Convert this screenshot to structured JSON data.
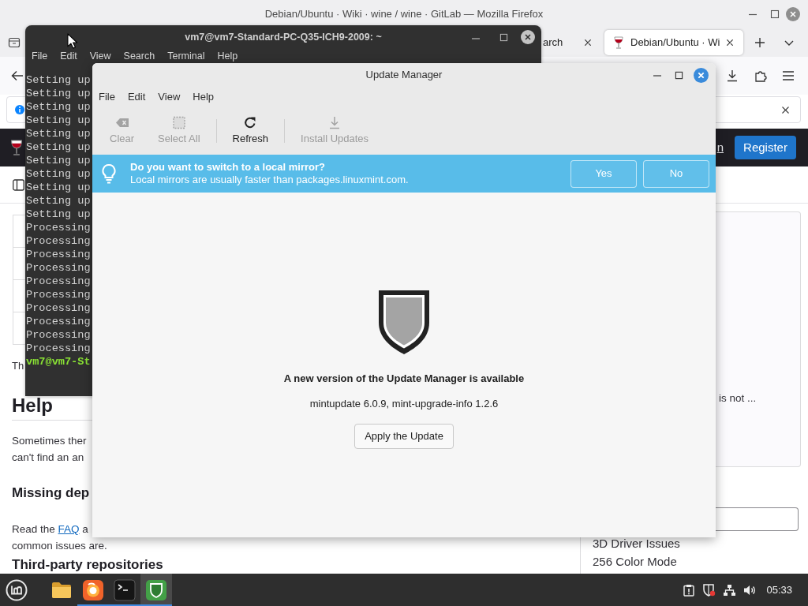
{
  "firefox": {
    "title": "Debian/Ubuntu · Wiki · wine / wine · GitLab — Mozilla Firefox",
    "tabs": [
      {
        "label": "arch",
        "selected": false
      },
      {
        "label": "Debian/Ubuntu · Wi",
        "selected": true
      }
    ],
    "header": {
      "nav_link": "n",
      "register_button": "Register"
    },
    "article": {
      "intro": "Th",
      "heading": "Help",
      "paragraph": [
        "Sometimes ther",
        "can't find an an"
      ],
      "subheading": "Missing dep",
      "paragraph_2": {
        "before": "Read the ",
        "link": "FAQ",
        "after": " a",
        "line_2": "common issues are."
      },
      "subheading_2": "Third-party repositories"
    },
    "sidebar": {
      "panel_text": "is not ...",
      "links": [
        "3D Driver Issues",
        "256 Color Mode"
      ]
    }
  },
  "terminal": {
    "title": "vm7@vm7-Standard-PC-Q35-ICH9-2009: ~",
    "menu": [
      "File",
      "Edit",
      "View",
      "Search",
      "Terminal",
      "Help"
    ],
    "lines": [
      {
        "text": "Setting up",
        "kind": "output"
      },
      {
        "text": "Setting up",
        "kind": "output"
      },
      {
        "text": "Setting up",
        "kind": "output"
      },
      {
        "text": "Setting up",
        "kind": "output"
      },
      {
        "text": "Setting up",
        "kind": "output"
      },
      {
        "text": "Setting up",
        "kind": "output"
      },
      {
        "text": "Setting up",
        "kind": "output"
      },
      {
        "text": "Setting up",
        "kind": "output"
      },
      {
        "text": "Setting up",
        "kind": "output"
      },
      {
        "text": "Setting up",
        "kind": "output"
      },
      {
        "text": "Setting up",
        "kind": "output"
      },
      {
        "text": "Processing",
        "kind": "output"
      },
      {
        "text": "Processing",
        "kind": "output"
      },
      {
        "text": "Processing",
        "kind": "output"
      },
      {
        "text": "Processing",
        "kind": "output"
      },
      {
        "text": "Processing",
        "kind": "output"
      },
      {
        "text": "Processing",
        "kind": "output"
      },
      {
        "text": "Processing",
        "kind": "output"
      },
      {
        "text": "Processing",
        "kind": "output"
      },
      {
        "text": "Processing",
        "kind": "output"
      },
      {
        "text": "Processing",
        "kind": "output"
      },
      {
        "text": "vm7@vm7-St",
        "kind": "prompt"
      }
    ]
  },
  "update_manager": {
    "title": "Update Manager",
    "menu": [
      "File",
      "Edit",
      "View",
      "Help"
    ],
    "toolbar": [
      {
        "buttons": [
          {
            "label": "Clear",
            "disabled": true
          },
          {
            "label": "Select All",
            "disabled": true
          }
        ]
      },
      {
        "buttons": [
          {
            "label": "Refresh",
            "disabled": false
          }
        ]
      },
      {
        "buttons": [
          {
            "label": "Install Updates",
            "disabled": true
          }
        ]
      }
    ],
    "info_bar": {
      "title": "Do you want to switch to a local mirror?",
      "message": "Local mirrors are usually faster than packages.linuxmint.com.",
      "buttons": [
        "Yes",
        "No"
      ]
    },
    "notice": {
      "heading": "A new version of the Update Manager is available",
      "versions": "mintupdate 6.0.9, mint-upgrade-info 1.2.6",
      "button": "Apply the Update"
    }
  },
  "taskbar": {
    "apps": [
      {
        "running": false,
        "active": false
      },
      {
        "running": true,
        "active": false
      },
      {
        "running": true,
        "active": false
      },
      {
        "running": true,
        "active": true
      }
    ],
    "clock": "05:33"
  }
}
